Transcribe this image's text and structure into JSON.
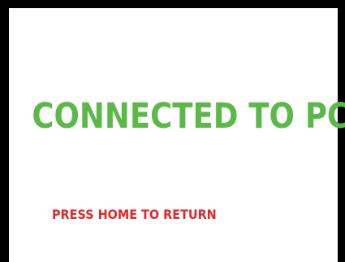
{
  "screen": {
    "status_message": "CONNECTED TO PC",
    "hint_message": "PRESS HOME TO RETURN"
  },
  "colors": {
    "status": "#5ab947",
    "hint": "#e0262b",
    "frame": "#000000",
    "background": "#ffffff"
  }
}
